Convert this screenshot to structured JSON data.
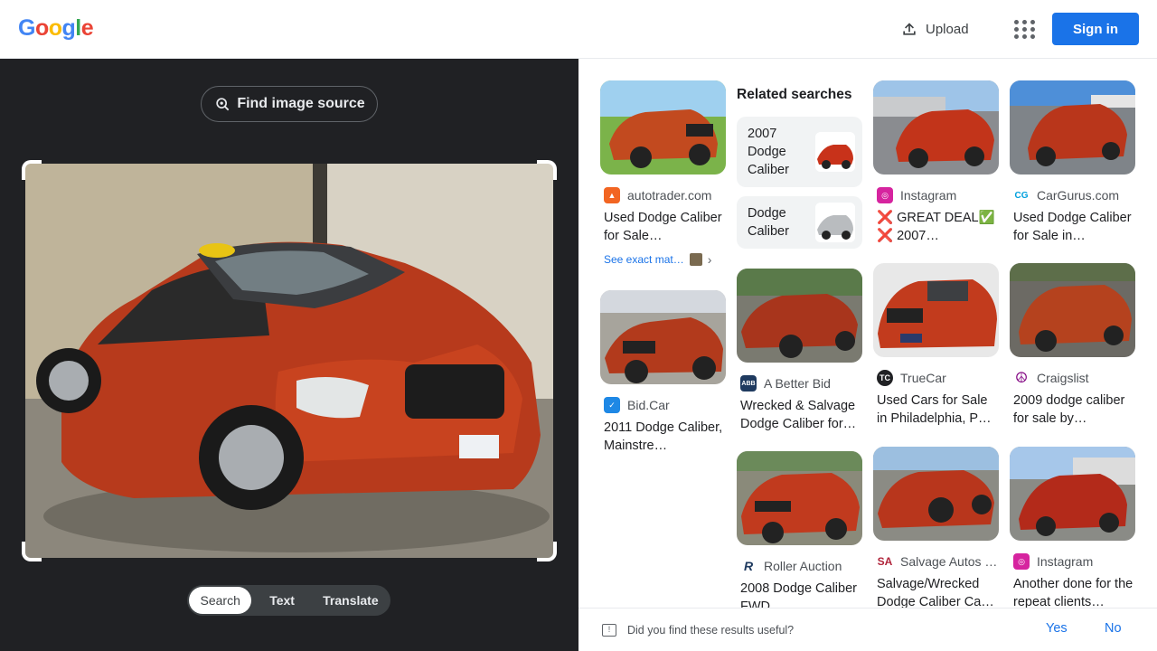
{
  "header": {
    "logo": [
      "G",
      "o",
      "o",
      "g",
      "l",
      "e"
    ],
    "logo_colors": [
      "#4285f4",
      "#ea4335",
      "#fbbc05",
      "#4285f4",
      "#34a853",
      "#ea4335"
    ],
    "upload_label": "Upload",
    "signin_label": "Sign in"
  },
  "left": {
    "find_source_label": "Find image source",
    "modes": [
      "Search",
      "Text",
      "Translate"
    ],
    "active_mode": "Search"
  },
  "related": {
    "title": "Related searches",
    "items": [
      {
        "label": "2007 Dodge Caliber"
      },
      {
        "label": "Dodge Caliber"
      }
    ]
  },
  "results": [
    {
      "source": "autotrader.com",
      "title": "Used Dodge Caliber for Sale…",
      "icon": "autotrader-icon",
      "color": "#f26522",
      "exact": "See exact mat…"
    },
    {
      "source": "Bid.Car",
      "title": "2011 Dodge Caliber, Mainstre…",
      "icon": "bidcar-icon",
      "color": "#1e88e5"
    },
    {
      "source": "A Better Bid",
      "title": "Wrecked & Salvage Dodge Caliber for…",
      "icon": "abetterbid-icon",
      "color": "#1f3a5f"
    },
    {
      "source": "Roller Auction",
      "title": "2008 Dodge Caliber FWD",
      "icon": "roller-icon",
      "color": "#1f3a5f"
    },
    {
      "source": "Instagram",
      "title": "❌ GREAT DEAL✅ ❌ 2007…",
      "icon": "instagram-icon",
      "color": "#d6249f"
    },
    {
      "source": "TrueCar",
      "title": "Used Cars for Sale in Philadelphia, P…",
      "icon": "truecar-icon",
      "color": "#202124"
    },
    {
      "source": "Salvage Autos …",
      "title": "Salvage/Wrecked Dodge Caliber Ca…",
      "icon": "salvageautos-icon",
      "color": "#b0243a"
    },
    {
      "source": "CarGurus.com",
      "title": "Used Dodge Caliber for Sale in…",
      "icon": "cargurus-icon",
      "color": "#00a0dd"
    },
    {
      "source": "Craigslist",
      "title": "2009 dodge caliber for sale by…",
      "icon": "craigslist-icon",
      "color": "#800080"
    },
    {
      "source": "Instagram",
      "title": "Another done for the repeat clients…",
      "icon": "instagram-icon",
      "color": "#d6249f"
    }
  ],
  "feedback": {
    "question": "Did you find these results useful?",
    "yes": "Yes",
    "no": "No"
  }
}
